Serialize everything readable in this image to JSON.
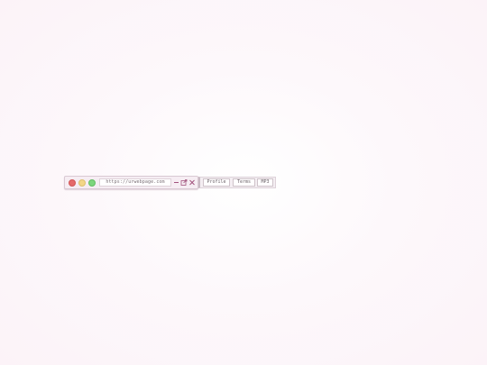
{
  "browser": {
    "url": "https://urwebpage.com",
    "controls": {
      "minimize_icon": "minus-icon",
      "external_icon": "external-link-icon",
      "close_icon": "close-icon"
    },
    "traffic_lights": {
      "close_color": "#e56a6a",
      "minimize_color": "#f3d687",
      "maximize_color": "#7dd67d"
    },
    "accent_color": "#a2547e"
  },
  "nav": {
    "items": [
      {
        "label": "Profile"
      },
      {
        "label": "Terms"
      },
      {
        "label": "MP3"
      }
    ]
  }
}
